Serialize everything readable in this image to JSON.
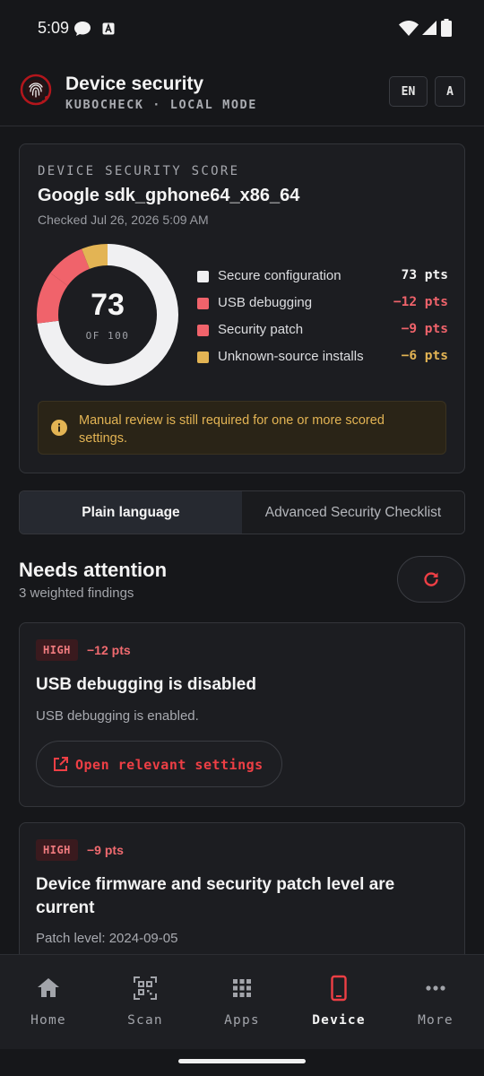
{
  "status_bar": {
    "time": "5:09"
  },
  "header": {
    "title": "Device security",
    "subtitle": "KUBOCHECK · LOCAL MODE",
    "lang_button": "EN",
    "text_button": "A"
  },
  "score_card": {
    "label": "DEVICE SECURITY SCORE",
    "device": "Google sdk_gphone64_x86_64",
    "checked": "Checked Jul 26, 2026 5:09 AM",
    "score": "73",
    "score_of": "OF 100",
    "legend": [
      {
        "label": "Secure configuration",
        "pts": "73 pts",
        "color": "#f0f0f2",
        "pts_color": "#f4f4f4"
      },
      {
        "label": "USB debugging",
        "pts": "−12 pts",
        "color": "#f0636b",
        "pts_color": "#f0636b"
      },
      {
        "label": "Security patch",
        "pts": "−9 pts",
        "color": "#f0636b",
        "pts_color": "#f0636b"
      },
      {
        "label": "Unknown-source installs",
        "pts": "−6 pts",
        "color": "#e3b454",
        "pts_color": "#e3b454"
      }
    ],
    "warning": "Manual review is still required for one or more scored settings."
  },
  "tabs": {
    "plain": "Plain language",
    "advanced": "Advanced Security Checklist"
  },
  "section": {
    "title": "Needs attention",
    "subtitle": "3 weighted findings"
  },
  "findings": [
    {
      "severity": "HIGH",
      "pts": "−12 pts",
      "title": "USB debugging is disabled",
      "desc": "USB debugging is enabled.",
      "action": "Open relevant settings"
    },
    {
      "severity": "HIGH",
      "pts": "−9 pts",
      "title": "Device firmware and security patch level are current",
      "desc": "Patch level: 2024-09-05"
    }
  ],
  "nav": [
    {
      "label": "Home",
      "icon": "home-icon"
    },
    {
      "label": "Scan",
      "icon": "qr-scan-icon"
    },
    {
      "label": "Apps",
      "icon": "grid-icon"
    },
    {
      "label": "Device",
      "icon": "phone-icon",
      "active": true
    },
    {
      "label": "More",
      "icon": "more-icon"
    }
  ],
  "colors": {
    "accent": "#ee3f45",
    "warning": "#e3b454",
    "background": "#16171a"
  }
}
